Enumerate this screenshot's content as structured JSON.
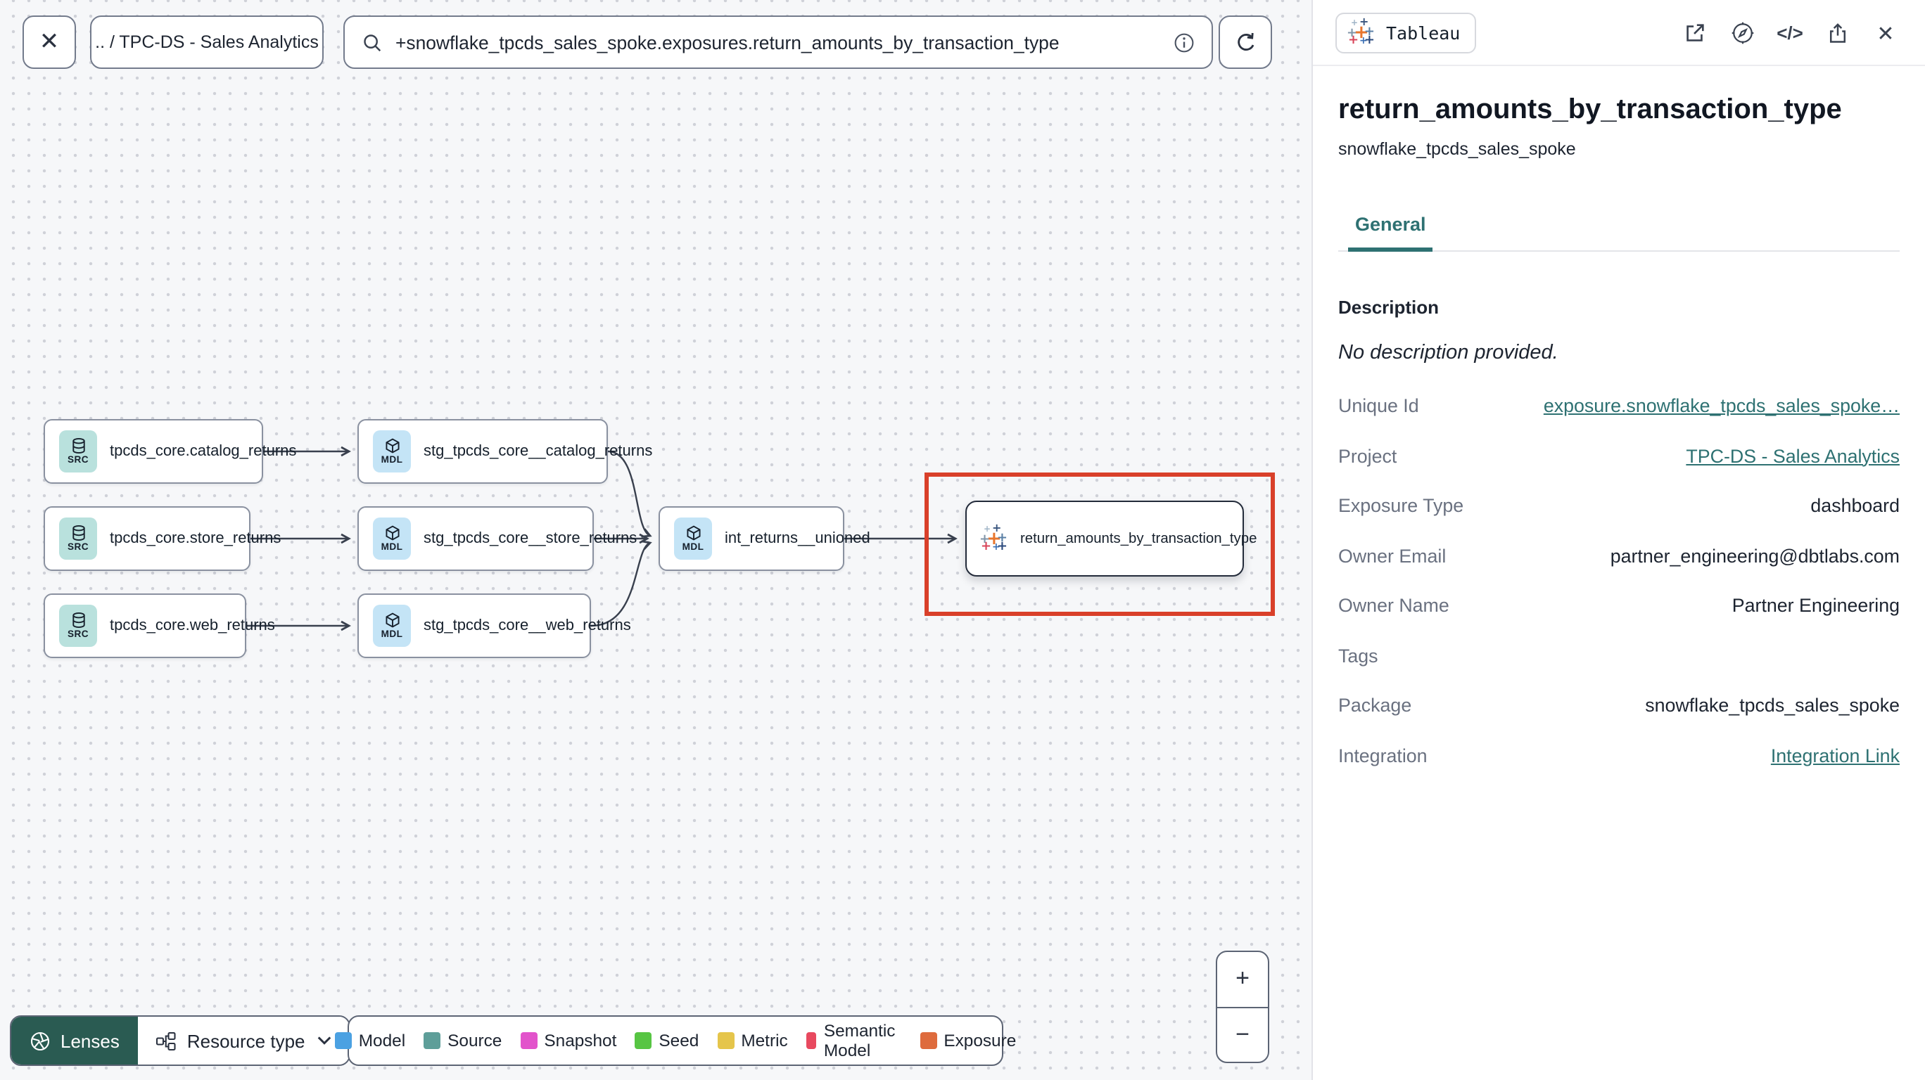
{
  "topbar": {
    "breadcrumb": ".. / TPC-DS - Sales Analytics",
    "search_value": "+snowflake_tpcds_sales_spoke.exposures.return_amounts_by_transaction_type"
  },
  "graph": {
    "nodes": [
      {
        "badge": "SRC",
        "label": "tpcds_core.catalog_returns"
      },
      {
        "badge": "SRC",
        "label": "tpcds_core.store_returns"
      },
      {
        "badge": "SRC",
        "label": "tpcds_core.web_returns"
      },
      {
        "badge": "MDL",
        "label": "stg_tpcds_core__catalog_returns"
      },
      {
        "badge": "MDL",
        "label": "stg_tpcds_core__store_returns"
      },
      {
        "badge": "MDL",
        "label": "stg_tpcds_core__web_returns"
      },
      {
        "badge": "MDL",
        "label": "int_returns__unioned"
      },
      {
        "badge": "",
        "label": "return_amounts_by_transaction_type"
      }
    ]
  },
  "toolbar": {
    "lenses_label": "Lenses",
    "resource_type_label": "Resource type"
  },
  "legend": {
    "items": [
      {
        "label": "Model",
        "color": "#4BA1E2"
      },
      {
        "label": "Source",
        "color": "#5E9E99"
      },
      {
        "label": "Snapshot",
        "color": "#E253CB"
      },
      {
        "label": "Seed",
        "color": "#57C543"
      },
      {
        "label": "Metric",
        "color": "#E5C54B"
      },
      {
        "label": "Semantic Model",
        "color": "#E8495F"
      },
      {
        "label": "Exposure",
        "color": "#DE6B3D"
      }
    ]
  },
  "zoom_controls": {
    "zoom_in": "+",
    "zoom_out": "−"
  },
  "icons": {
    "code": "</>",
    "close": "✕"
  },
  "panel": {
    "source_badge": "Tableau",
    "title": "return_amounts_by_transaction_type",
    "subtitle": "snowflake_tpcds_sales_spoke",
    "tab_general": "General",
    "description_heading": "Description",
    "description_empty": "No description provided.",
    "fields": [
      {
        "label": "Unique Id",
        "value": "exposure.snowflake_tpcds_sales_spoke…",
        "link": true
      },
      {
        "label": "Project",
        "value": "TPC-DS - Sales Analytics",
        "link": true
      },
      {
        "label": "Exposure Type",
        "value": "dashboard",
        "link": false
      },
      {
        "label": "Owner Email",
        "value": "partner_engineering@dbtlabs.com",
        "link": false
      },
      {
        "label": "Owner Name",
        "value": "Partner Engineering",
        "link": false
      },
      {
        "label": "Tags",
        "value": "",
        "link": false
      },
      {
        "label": "Package",
        "value": "snowflake_tpcds_sales_spoke",
        "link": false
      },
      {
        "label": "Integration",
        "value": "Integration Link",
        "link": true
      }
    ]
  },
  "colors": {
    "accent_teal": "#2E7172",
    "selection_red": "#D9402A",
    "src_badge_bg": "#B9E1DD",
    "mdl_badge_bg": "#C4E4F6",
    "lenses_bg": "#2A5B52"
  }
}
